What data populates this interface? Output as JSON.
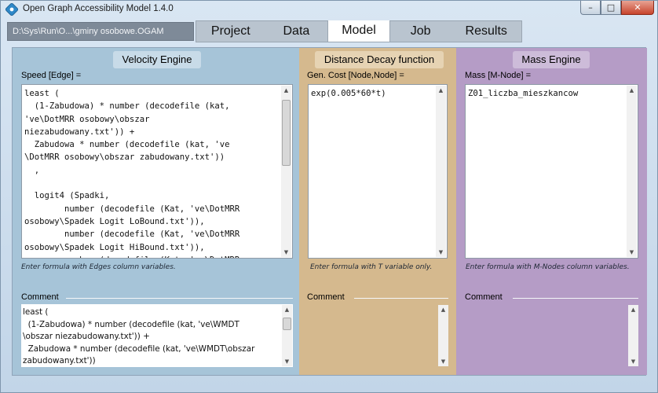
{
  "window": {
    "title": "Open Graph Accessibility Model 1.4.0",
    "minimize": "–",
    "maximize": "□",
    "close": "✕"
  },
  "path": "D:\\Sys\\Run\\O...\\gminy osobowe.OGAM",
  "tabs": [
    {
      "label": "Project",
      "active": false
    },
    {
      "label": "Data",
      "active": false
    },
    {
      "label": "Model",
      "active": true
    },
    {
      "label": "Job",
      "active": false
    },
    {
      "label": "Results",
      "active": false
    }
  ],
  "panels": {
    "velocity": {
      "title": "Velocity Engine",
      "field_label": "Speed [Edge] =",
      "formula": "least (\n  (1-Zabudowa) * number (decodefile (kat,\n've\\DotMRR osobowy\\obszar\nniezabudowany.txt')) +\n  Zabudowa * number (decodefile (kat, 've\n\\DotMRR osobowy\\obszar zabudowany.txt'))\n  ,\n\n  logit4 (Spadki,\n        number (decodefile (Kat, 've\\DotMRR\nosobowy\\Spadek Logit LoBound.txt')),\n        number (decodefile (Kat, 've\\DotMRR\nosobowy\\Spadek Logit HiBound.txt')),\n        number (decodefile (Kat, 've\\DotMRR",
      "hint": "Enter formula with Edges column variables.",
      "comment_label": "Comment",
      "comment": "least (\n  (1-Zabudowa) * number (decodefile (kat, 've\\WMDT\n\\obszar niezabudowany.txt')) +\n  Zabudowa * number (decodefile (kat, 've\\WMDT\\obszar\nzabudowany.txt'))"
    },
    "distance": {
      "title": "Distance Decay function",
      "field_label": "Gen. Cost [Node,Node] =",
      "formula": "exp(0.005*60*t)",
      "hint": "Enter formula with T variable only.",
      "comment_label": "Comment",
      "comment": ""
    },
    "mass": {
      "title": "Mass Engine",
      "field_label": "Mass [M-Node] =",
      "formula": "Z01_liczba_mieszkancow",
      "hint": "Enter formula with M-Nodes column variables.",
      "comment_label": "Comment",
      "comment": ""
    }
  },
  "scroll_arrows": {
    "up": "▲",
    "down": "▼"
  },
  "colors": {
    "velocity_bg": "#a6c4d8",
    "distance_bg": "#d5b98e",
    "mass_bg": "#b59cc6",
    "path_bg": "#7e8a98",
    "close_button": "#c7442c"
  }
}
